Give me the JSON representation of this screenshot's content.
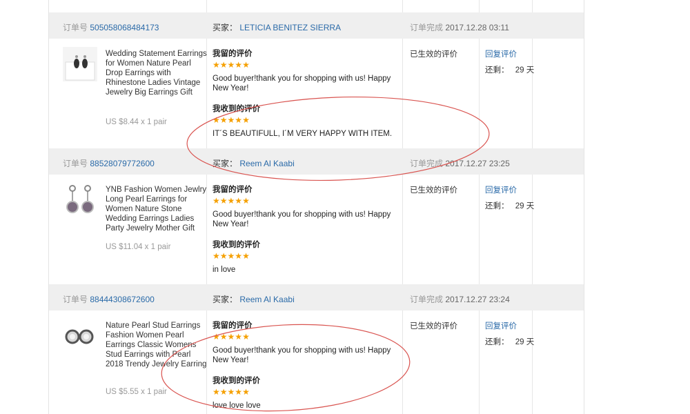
{
  "labels": {
    "order_no": "订单号",
    "buyer": "买家：",
    "completed": "订单完成",
    "my_feedback": "我留的评价",
    "received_feedback": "我收到的评价",
    "reply": "回复评价",
    "remaining": "还剩：",
    "status": "已生效的评价"
  },
  "orders": [
    {
      "order_id": "505058068484173",
      "buyer": "LETICIA BENITEZ SIERRA",
      "completed_time": "2017.12.28 03:11",
      "product_title": "Wedding Statement Earrings for Women Nature Pearl Drop Earrings with Rhinestone Ladies Vintage Jewelry Big Earrings Gift",
      "price": "US $8.44 x 1 pair",
      "my_rating": 5,
      "my_comment": "Good buyer!thank you for shopping with us! Happy New Year!",
      "received_rating": 5,
      "received_comment": "IT´S BEAUTIFULL, I´M VERY HAPPY WITH ITEM.",
      "remaining_days": "29 天"
    },
    {
      "order_id": "88528079772600",
      "buyer": "Reem Al Kaabi",
      "completed_time": "2017.12.27 23:25",
      "product_title": "YNB Fashion Women Jewlry Long Pearl Earrings for Women Nature Stone Wedding Earrings Ladies Party Jewelry Mother Gift",
      "price": "US $11.04 x 1 pair",
      "my_rating": 5,
      "my_comment": "Good buyer!thank you for shopping with us! Happy New Year!",
      "received_rating": 5,
      "received_comment": "in love",
      "remaining_days": "29 天"
    },
    {
      "order_id": "88444308672600",
      "buyer": "Reem Al Kaabi",
      "completed_time": "2017.12.27 23:24",
      "product_title": "Nature Pearl Stud Earrings Fashion Women Pearl Earrings Classic Womens Stud Earrings with Pearl 2018 Trendy Jewelry Earring",
      "price": "US $5.55 x 1 pair",
      "my_rating": 5,
      "my_comment": "Good buyer!thank you for shopping with us! Happy New Year!",
      "received_rating": 5,
      "received_comment": "love love love",
      "remaining_days": "29 天"
    }
  ],
  "colors": {
    "link": "#2a6aa8",
    "star": "#f5a000",
    "header_bg": "#efefef",
    "annotation": "#d9534f"
  },
  "icons": {
    "star": "star-icon",
    "product": "earring-thumbnail"
  }
}
